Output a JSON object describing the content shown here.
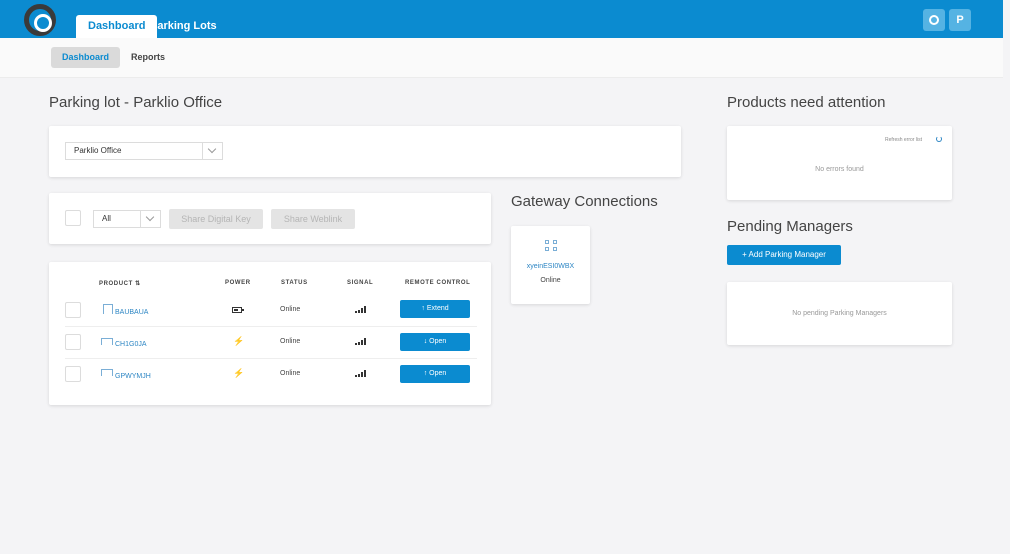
{
  "topnav": {
    "tabs": [
      {
        "label": "Dashboard",
        "active": true
      },
      {
        "label": "Parking Lots",
        "active": false
      }
    ],
    "profile_initial": "P",
    "settings_icon": "gear-icon"
  },
  "subnav": {
    "tabs": [
      {
        "label": "Dashboard",
        "active": true
      },
      {
        "label": "Reports",
        "active": false
      }
    ]
  },
  "main": {
    "page_title": "Parking lot - Parklio Office",
    "lot_select": {
      "value": "Parklio Office"
    },
    "filter": {
      "value": "All",
      "share_key_label": "Share Digital Key",
      "share_weblink_label": "Share Weblink"
    },
    "table": {
      "headers": {
        "product": "PRODUCT",
        "power": "POWER",
        "status": "STATUS",
        "signal": "SIGNAL",
        "remote": "REMOTE CONTROL"
      },
      "rows": [
        {
          "product": "BAUBAUA",
          "power": "battery",
          "status": "Online",
          "signal": "signal-bars",
          "action": "Extend",
          "action_arrow": "↑"
        },
        {
          "product": "CH1G0JA",
          "power": "bolt",
          "status": "Online",
          "signal": "signal-bars",
          "action": "Open",
          "action_arrow": "↓"
        },
        {
          "product": "GPWYMJH",
          "power": "bolt",
          "status": "Online",
          "signal": "signal-bars",
          "action": "Open",
          "action_arrow": "↑"
        }
      ]
    }
  },
  "gateway": {
    "title": "Gateway Connections",
    "items": [
      {
        "name": "xyeinESI0WBX",
        "status": "Online"
      }
    ]
  },
  "attention": {
    "title": "Products need attention",
    "refresh_label": "Refresh error list",
    "empty": "No errors found"
  },
  "managers": {
    "title": "Pending Managers",
    "add_label": "+ Add Parking Manager",
    "empty": "No pending Parking Managers"
  },
  "colors": {
    "brand": "#0b8bd0",
    "link": "#2d86c4"
  }
}
